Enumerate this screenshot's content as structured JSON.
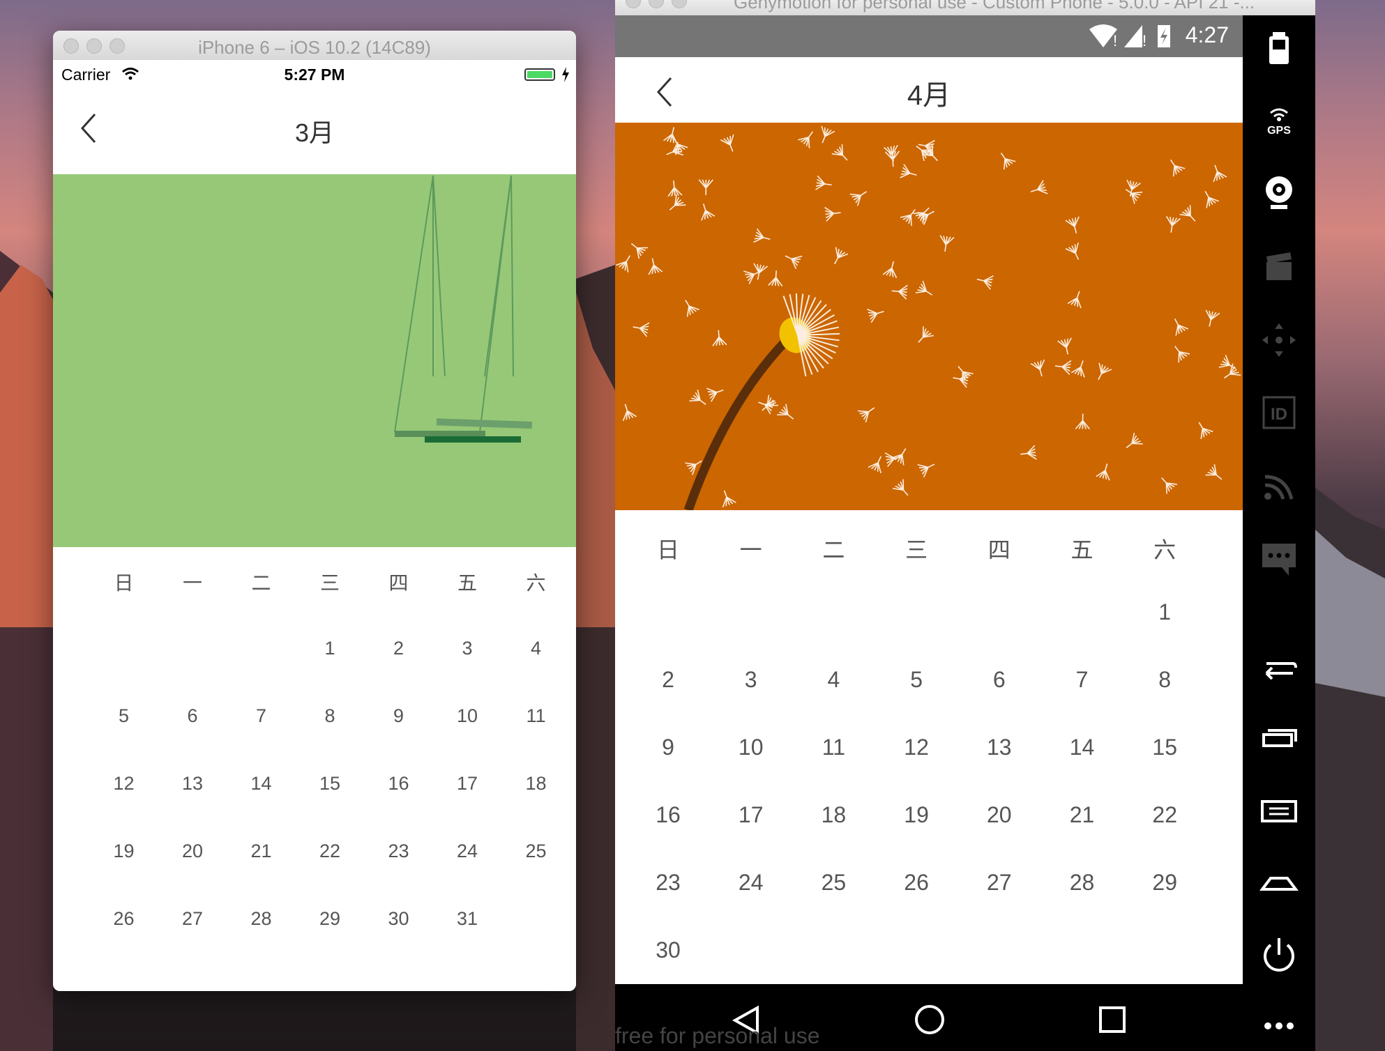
{
  "ios": {
    "window_title": "iPhone 6 – iOS 10.2 (14C89)",
    "status": {
      "carrier": "Carrier",
      "time": "5:27 PM"
    },
    "nav": {
      "title": "3月"
    },
    "banner_color": "#97c878",
    "weekdays": [
      "日",
      "一",
      "二",
      "三",
      "四",
      "五",
      "六"
    ],
    "days": [
      [
        "",
        "",
        "",
        "1",
        "2",
        "3",
        "4"
      ],
      [
        "5",
        "6",
        "7",
        "8",
        "9",
        "10",
        "11"
      ],
      [
        "12",
        "13",
        "14",
        "15",
        "16",
        "17",
        "18"
      ],
      [
        "19",
        "20",
        "21",
        "22",
        "23",
        "24",
        "25"
      ],
      [
        "26",
        "27",
        "28",
        "29",
        "30",
        "31",
        ""
      ]
    ]
  },
  "android": {
    "window_title": "Genymotion for personal use - Custom Phone - 5.0.0 - API 21 -...",
    "status": {
      "time": "4:27"
    },
    "nav": {
      "title": "4月"
    },
    "banner_color": "#cc6600",
    "weekdays": [
      "日",
      "一",
      "二",
      "三",
      "四",
      "五",
      "六"
    ],
    "days": [
      [
        "",
        "",
        "",
        "",
        "",
        "",
        "1"
      ],
      [
        "2",
        "3",
        "4",
        "5",
        "6",
        "7",
        "8"
      ],
      [
        "9",
        "10",
        "11",
        "12",
        "13",
        "14",
        "15"
      ],
      [
        "16",
        "17",
        "18",
        "19",
        "20",
        "21",
        "22"
      ],
      [
        "23",
        "24",
        "25",
        "26",
        "27",
        "28",
        "29"
      ],
      [
        "30",
        "",
        "",
        "",
        "",
        "",
        ""
      ]
    ],
    "watermark": "free for personal use",
    "side_toolbar": [
      "battery-icon",
      "gps-icon",
      "webcam-icon",
      "video-capture-icon",
      "dpad-icon",
      "id-icon",
      "cast-icon",
      "sms-icon",
      "back-icon",
      "recent-apps-icon",
      "menu-icon",
      "home-icon",
      "power-icon",
      "more-icon"
    ],
    "side_gps_label": "GPS",
    "side_id_label": "ID"
  }
}
